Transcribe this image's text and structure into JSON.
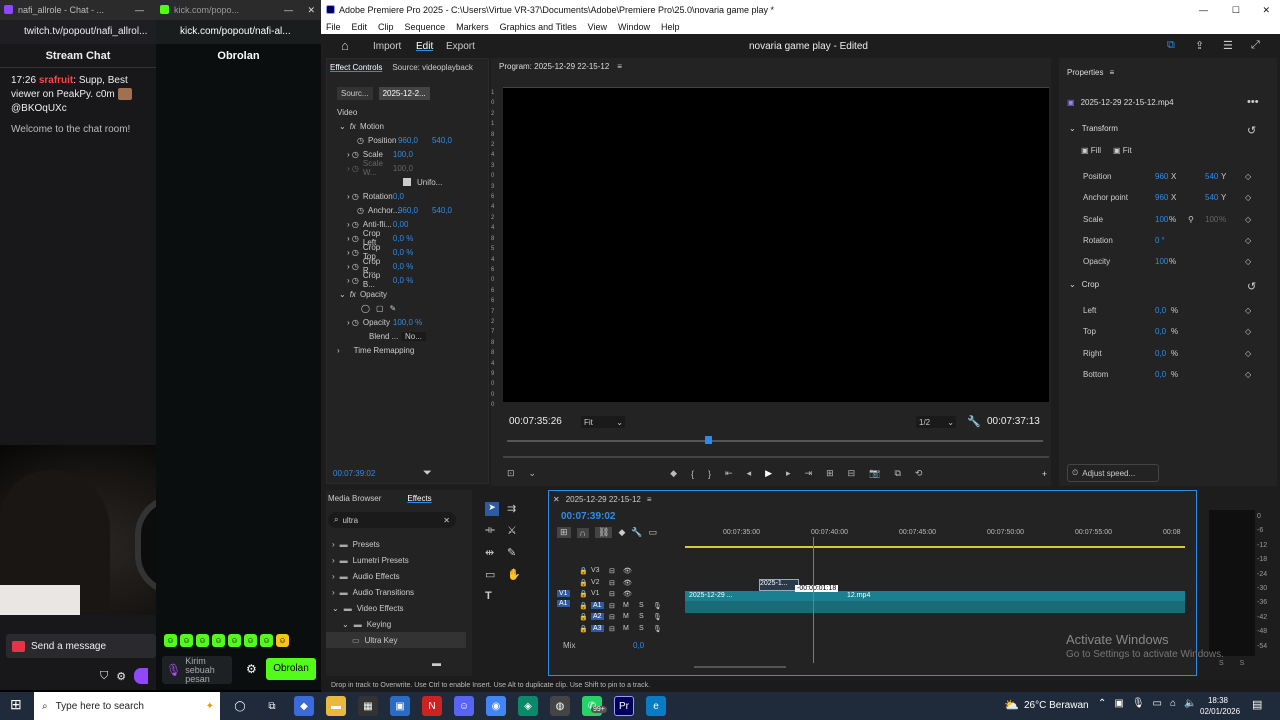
{
  "twitch": {
    "tab_title": "nafi_allrole - Chat - ...",
    "url": "twitch.tv/popout/nafi_allrol...",
    "chat_title": "Stream Chat",
    "message_time": "17:26",
    "message_user": "srafruit",
    "message_text": ": Supp, Best viewer on PeakPy. c0m",
    "message_mention": "@BKOqUXc",
    "welcome": "Welcome to the chat room!",
    "send_placeholder": "Send a message"
  },
  "kick": {
    "tab_title": "kick.com/popo...",
    "url": "kick.com/popout/nafi-al...",
    "chat_title": "Obrolan",
    "send_placeholder": "Kirim sebuah pesan",
    "send_button": "Obrolan"
  },
  "premiere": {
    "title": "Adobe Premiere Pro 2025 - C:\\Users\\Virtue VR-37\\Documents\\Adobe\\Premiere Pro\\25.0\\novaria game play *",
    "menu": [
      "File",
      "Edit",
      "Clip",
      "Sequence",
      "Markers",
      "Graphics and Titles",
      "View",
      "Window",
      "Help"
    ],
    "nav": {
      "import": "Import",
      "edit": "Edit",
      "export": "Export"
    },
    "project_title": "novaria game play",
    "project_status": "- Edited",
    "effect_controls": {
      "tab1": "Effect Controls",
      "tab2": "Source: videoplayback",
      "src_tab": "Sourc...",
      "seq_tab": "2025-12-2...",
      "section_video": "Video",
      "motion": "Motion",
      "position": "Position",
      "position_x": "960,0",
      "position_y": "540,0",
      "scale": "Scale",
      "scale_val": "100,0",
      "scale_w": "Scale W...",
      "scale_w_val": "100,0",
      "uniform": "Unifo...",
      "rotation": "Rotation",
      "rotation_val": "0,0",
      "anchor": "Anchor...",
      "anchor_x": "960,0",
      "anchor_y": "540,0",
      "antiflicker": "Anti-fli...",
      "antiflicker_val": "0,00",
      "crop_left": "Crop Left",
      "crop_left_val": "0,0 %",
      "crop_top": "Crop Top",
      "crop_top_val": "0,0 %",
      "crop_right": "Crop R...",
      "crop_right_val": "0,0 %",
      "crop_bottom": "Crop B...",
      "crop_bottom_val": "0,0 %",
      "opacity_section": "Opacity",
      "opacity": "Opacity",
      "opacity_val": "100,0 %",
      "blend": "Blend ...",
      "blend_val": "No...",
      "time_remap": "Time Remapping",
      "timecode": "00:07:39:02"
    },
    "program": {
      "title": "Program: 2025-12-29 22-15-12",
      "ruler": [
        "1",
        "0",
        "2",
        "1",
        "8",
        "2",
        "4",
        "3",
        "0",
        "3",
        "6",
        "4",
        "2",
        "4",
        "8",
        "5",
        "4",
        "6",
        "0",
        "6",
        "6",
        "7",
        "2",
        "7",
        "8",
        "8",
        "4",
        "9",
        "0",
        "0",
        "0"
      ],
      "timecode_left": "00:07:35:26",
      "fit": "Fit",
      "resolution": "1/2",
      "timecode_right": "00:07:37:13"
    },
    "properties": {
      "title": "Properties",
      "clip_name": "2025-12-29 22-15-12.mp4",
      "transform": "Transform",
      "fill": "Fill",
      "fit": "Fit",
      "position": "Position",
      "position_x": "960",
      "position_y": "540",
      "x_unit": "X",
      "y_unit": "Y",
      "anchor": "Anchor point",
      "anchor_x": "960",
      "anchor_y": "540",
      "scale": "Scale",
      "scale_val": "100",
      "scale_val2": "100",
      "pct": "%",
      "rotation": "Rotation",
      "rotation_val": "0 °",
      "opacity": "Opacity",
      "opacity_val": "100",
      "crop": "Crop",
      "left": "Left",
      "left_val": "0,0",
      "top": "Top",
      "top_val": "0,0",
      "right": "Right",
      "right_val": "0,0",
      "bottom": "Bottom",
      "bottom_val": "0,0",
      "adjust_speed": "Adjust speed..."
    },
    "effects_panel": {
      "tab_browser": "Media Browser",
      "tab_effects": "Effects",
      "search_value": "ultra",
      "items": [
        {
          "label": "Presets"
        },
        {
          "label": "Lumetri Presets"
        },
        {
          "label": "Audio Effects"
        },
        {
          "label": "Audio Transitions"
        },
        {
          "label": "Video Effects"
        },
        {
          "label": "Keying"
        },
        {
          "label": "Ultra Key"
        }
      ]
    },
    "timeline": {
      "title": "2025-12-29 22-15-12",
      "timecode": "00:07:39:02",
      "ruler": [
        "00:07:35:00",
        "00:07:40:00",
        "00:07:45:00",
        "00:07:50:00",
        "00:07:55:00",
        "00:08"
      ],
      "tracks_video": [
        "V3",
        "V2",
        "V1"
      ],
      "tracks_audio": [
        "A1",
        "A2",
        "A3"
      ],
      "src_v": "V1",
      "src_a": "A1",
      "mute": "M",
      "solo": "S",
      "mix": "Mix",
      "mix_val": "0,0",
      "clip_left": "2025-12-29 ...",
      "clip_right": "12.mp4",
      "clip_drag": "2025-1...",
      "drag_tooltip": "-00:00:01:18"
    },
    "meter_ticks": [
      "0",
      "-6",
      "-12",
      "-18",
      "-24",
      "-30",
      "-36",
      "-42",
      "-48",
      "-54"
    ],
    "meter_labels": [
      "S",
      "S"
    ],
    "watermark_title": "Activate Windows",
    "watermark_sub": "Go to Settings to activate Windows.",
    "status_text": "Drop in track to Overwrite. Use Ctrl to enable Insert. Use Alt to duplicate clip. Use Shift to pin to a track."
  },
  "taskbar": {
    "search_placeholder": "Type here to search",
    "weather": "26°C Berawan",
    "time": "18:38",
    "date": "02/01/2026",
    "badge": "99+"
  }
}
